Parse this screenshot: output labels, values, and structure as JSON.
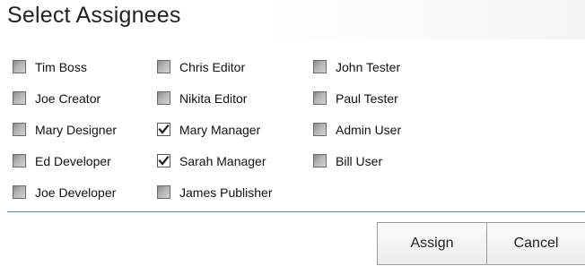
{
  "dialog": {
    "title": "Select Assignees",
    "assignees": [
      {
        "label": "Tim Boss",
        "checked": false
      },
      {
        "label": "Chris Editor",
        "checked": false
      },
      {
        "label": "John Tester",
        "checked": false
      },
      {
        "label": "Joe Creator",
        "checked": false
      },
      {
        "label": "Nikita Editor",
        "checked": false
      },
      {
        "label": "Paul Tester",
        "checked": false
      },
      {
        "label": "Mary Designer",
        "checked": false
      },
      {
        "label": "Mary Manager",
        "checked": true
      },
      {
        "label": "Admin User",
        "checked": false
      },
      {
        "label": "Ed Developer",
        "checked": false
      },
      {
        "label": "Sarah Manager",
        "checked": true
      },
      {
        "label": "Bill User",
        "checked": false
      },
      {
        "label": "Joe Developer",
        "checked": false
      },
      {
        "label": "James Publisher",
        "checked": false
      }
    ],
    "buttons": {
      "assign_label": "Assign",
      "cancel_label": "Cancel"
    }
  }
}
